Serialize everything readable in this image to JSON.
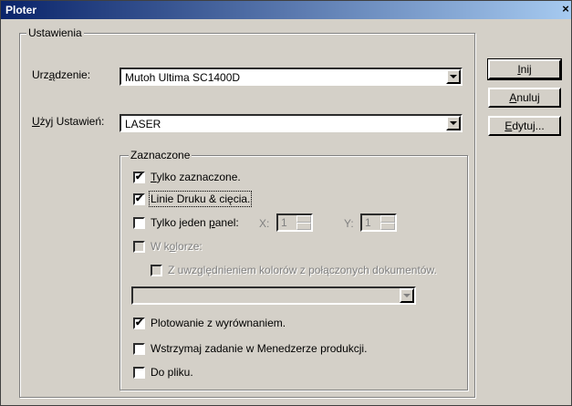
{
  "window": {
    "title": "Ploter",
    "close_label": "×"
  },
  "settings_group": {
    "label": "Ustawienia"
  },
  "device": {
    "label": "Urządzenie:",
    "value": "Mutoh Ultima SC1400D"
  },
  "use_settings": {
    "label": "Użyj Ustawień:",
    "value": "LASER"
  },
  "selected_group": {
    "label": "Zaznaczone"
  },
  "options": {
    "only_selected": {
      "label": "Tylko zaznaczone.",
      "checked": "✔"
    },
    "print_cut_lines": {
      "label": "Linie Druku & cięcia.",
      "checked": "✔"
    },
    "single_panel": {
      "label": "Tylko jeden panel:",
      "checked": ""
    },
    "in_color": {
      "label": "W kolorze:",
      "checked": ""
    },
    "linked_colors": {
      "label": "Z uwzględnieniem kolorów z połączonych dokumentów.",
      "checked": ""
    },
    "plot_align": {
      "label": "Plotowanie z wyrównaniem.",
      "checked": "✔"
    },
    "hold_job": {
      "label": "Wstrzymaj zadanie w Menedzerze produkcji.",
      "checked": ""
    },
    "to_file": {
      "label": "Do pliku.",
      "checked": ""
    }
  },
  "panel_x": {
    "label": "X:",
    "value": "1"
  },
  "panel_y": {
    "label": "Y:",
    "value": "1"
  },
  "color_select": {
    "value": ""
  },
  "buttons": {
    "ok": "Inij",
    "cancel": "Anuluj",
    "edit": "Edytuj..."
  }
}
